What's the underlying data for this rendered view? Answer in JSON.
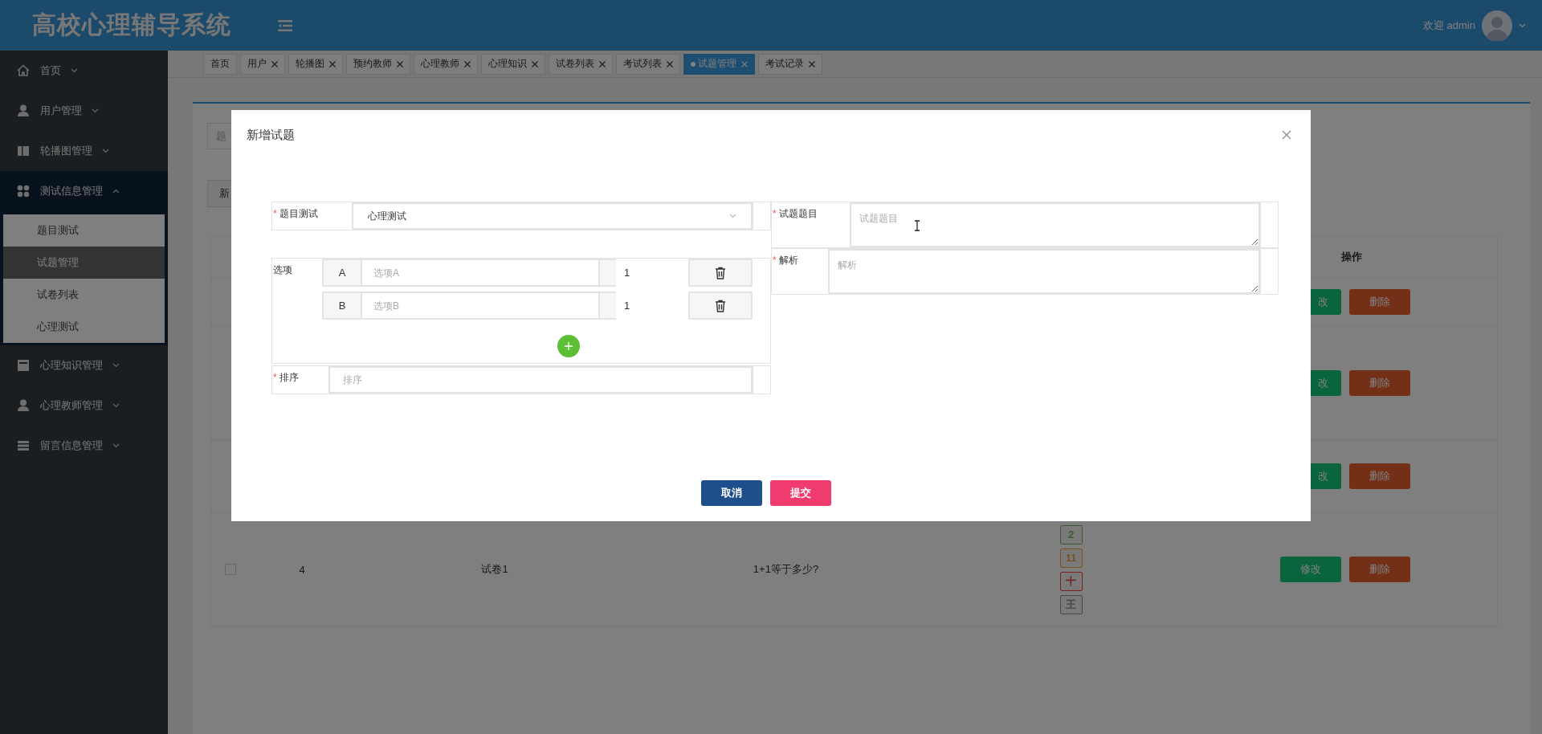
{
  "header": {
    "title": "高校心理辅导系统",
    "welcome": "欢迎 admin"
  },
  "sidebar": {
    "items": [
      {
        "label": "首页",
        "kind": "home",
        "expanded": false
      },
      {
        "label": "用户管理",
        "kind": "user",
        "expanded": false
      },
      {
        "label": "轮播图管理",
        "kind": "columns",
        "expanded": false
      },
      {
        "label": "测试信息管理",
        "kind": "grid",
        "expanded": true,
        "children": [
          {
            "label": "题目测试",
            "selected": false
          },
          {
            "label": "试题管理",
            "selected": true
          },
          {
            "label": "试卷列表",
            "selected": false
          },
          {
            "label": "心理测试",
            "selected": false
          }
        ]
      },
      {
        "label": "心理知识管理",
        "kind": "book",
        "expanded": false
      },
      {
        "label": "心理教师管理",
        "kind": "user",
        "expanded": false
      },
      {
        "label": "留言信息管理",
        "kind": "list",
        "expanded": false
      }
    ]
  },
  "tabs": [
    {
      "label": "首页",
      "closable": false,
      "selected": false
    },
    {
      "label": "用户",
      "closable": true,
      "selected": false
    },
    {
      "label": "轮播图",
      "closable": true,
      "selected": false
    },
    {
      "label": "预约教师",
      "closable": true,
      "selected": false
    },
    {
      "label": "心理教师",
      "closable": true,
      "selected": false
    },
    {
      "label": "心理知识",
      "closable": true,
      "selected": false
    },
    {
      "label": "试卷列表",
      "closable": true,
      "selected": false
    },
    {
      "label": "考试列表",
      "closable": true,
      "selected": false
    },
    {
      "label": "试题管理",
      "closable": true,
      "selected": true
    },
    {
      "label": "考试记录",
      "closable": true,
      "selected": false
    }
  ],
  "content": {
    "search_field": {
      "placeholder": "题"
    },
    "add_button": "新",
    "table": {
      "columns": [
        {
          "label": "操作"
        }
      ],
      "rows": [
        {
          "actions": [
            "改",
            "删除"
          ]
        },
        {
          "actions": [
            "改",
            "删除"
          ]
        },
        {
          "actions": [
            "改",
            "删除"
          ]
        },
        {
          "checked": false,
          "cells": [
            "4",
            "试卷1",
            "1+1等于多少?"
          ],
          "tags": [
            {
              "label": "2",
              "color": "#3a5a30"
            },
            {
              "label": "11",
              "color": "#7a5020"
            },
            {
              "label": "十",
              "color": "#7a2020"
            },
            {
              "label": "王",
              "color": "#484848"
            }
          ],
          "actions": [
            "修改",
            "删除"
          ]
        }
      ]
    }
  },
  "dialog": {
    "title": "新增试题",
    "topic": {
      "label": "题目测试",
      "required_mark": "*",
      "value": "心理测试"
    },
    "options": {
      "label": "选项",
      "items": [
        {
          "letter": "A",
          "placeholder": "选项A",
          "score": "1"
        },
        {
          "letter": "B",
          "placeholder": "选项B",
          "score": "1"
        }
      ]
    },
    "sort": {
      "label": "排序",
      "required_mark": "*",
      "placeholder": "排序"
    },
    "question": {
      "label": "试题题目",
      "required_mark": "*",
      "placeholder": "试题题目"
    },
    "analysis": {
      "label": "解析",
      "required_mark": "*",
      "placeholder": "解析"
    },
    "buttons": [
      {
        "label": "取消",
        "kind": "cancel"
      },
      {
        "label": "提交",
        "kind": "submit"
      }
    ]
  }
}
